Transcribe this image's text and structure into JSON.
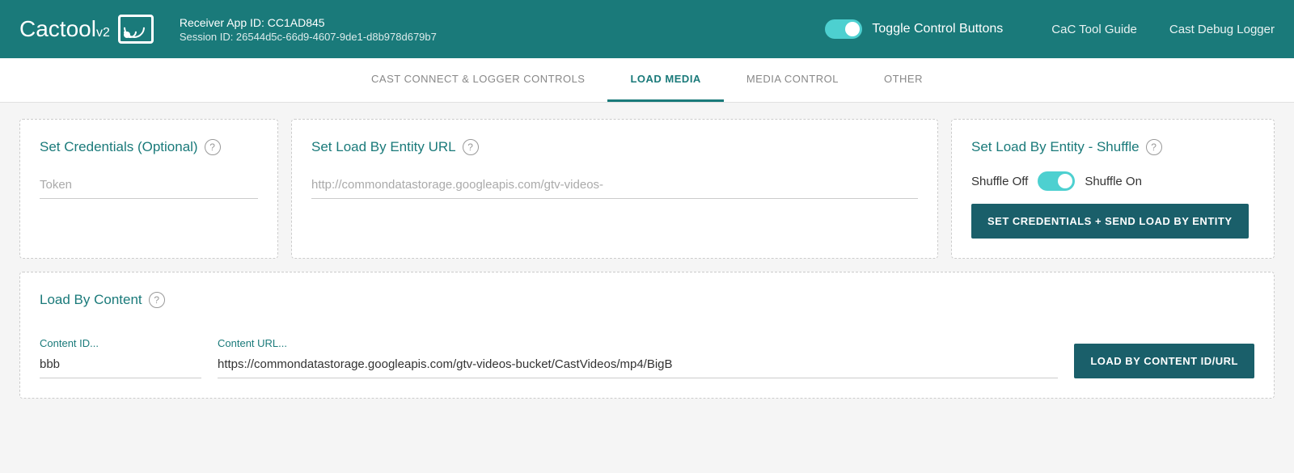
{
  "header": {
    "logo_text": "Cactool",
    "logo_version": "v2",
    "receiver_label": "Receiver App ID: CC1AD845",
    "session_label": "Session ID: 26544d5c-66d9-4607-9de1-d8b978d679b7",
    "toggle_label": "Toggle Control Buttons",
    "nav_guide": "CaC Tool Guide",
    "nav_logger": "Cast Debug Logger"
  },
  "tabs": [
    {
      "label": "CAST CONNECT & LOGGER CONTROLS",
      "active": false
    },
    {
      "label": "LOAD MEDIA",
      "active": true
    },
    {
      "label": "MEDIA CONTROL",
      "active": false
    },
    {
      "label": "OTHER",
      "active": false
    }
  ],
  "cards": {
    "credentials": {
      "title": "Set Credentials (Optional)",
      "token_placeholder": "Token"
    },
    "entity_url": {
      "title": "Set Load By Entity URL",
      "url_placeholder": "http://commondatastorage.googleapis.com/gtv-videos-"
    },
    "shuffle": {
      "title": "Set Load By Entity - Shuffle",
      "shuffle_off_label": "Shuffle Off",
      "shuffle_on_label": "Shuffle On",
      "button_label": "SET CREDENTIALS + SEND LOAD BY ENTITY"
    },
    "load_content": {
      "title": "Load By Content",
      "content_id_label": "Content ID...",
      "content_id_value": "bbb",
      "content_url_label": "Content URL...",
      "content_url_value": "https://commondatastorage.googleapis.com/gtv-videos-bucket/CastVideos/mp4/BigB",
      "button_label": "LOAD BY CONTENT ID/URL"
    }
  }
}
